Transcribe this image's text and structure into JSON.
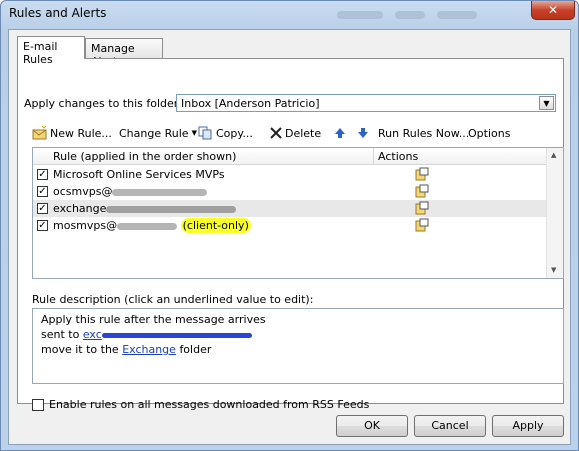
{
  "window": {
    "title": "Rules and Alerts",
    "close_glyph": "✕"
  },
  "tabs": [
    {
      "label": "E-mail Rules",
      "active": true
    },
    {
      "label": "Manage Alerts",
      "active": false
    }
  ],
  "folder": {
    "label": "Apply changes to this folder:",
    "value": "Inbox [Anderson Patricio]"
  },
  "toolbar": {
    "new_rule": "New Rule...",
    "change_rule": "Change Rule",
    "copy": "Copy...",
    "delete": "Delete",
    "run_rules": "Run Rules Now...",
    "options": "Options"
  },
  "rules_list": {
    "headers": {
      "rule": "Rule (applied in the order shown)",
      "actions": "Actions"
    },
    "rows": [
      {
        "checked": true,
        "prefix": "Microsoft Online Services MVPs",
        "redacted": false,
        "suffix": "",
        "selected": false
      },
      {
        "checked": true,
        "prefix": "ocsmvps@",
        "redacted": true,
        "suffix": "",
        "selected": false
      },
      {
        "checked": true,
        "prefix": "exchange",
        "redacted": true,
        "suffix": "",
        "selected": true
      },
      {
        "checked": true,
        "prefix": "mosmvps@",
        "redacted": true,
        "suffix": "(client-only)",
        "selected": false
      }
    ]
  },
  "description": {
    "label": "Rule description (click an underlined value to edit):",
    "line1": "Apply this rule after the message arrives",
    "line2_prefix": "sent to",
    "line2_link": "exc",
    "line3_prefix": "move it to the",
    "line3_link": "Exchange",
    "line3_suffix": "folder"
  },
  "rss_option": {
    "label": "Enable rules on all messages downloaded from RSS Feeds",
    "checked": false
  },
  "buttons": {
    "ok": "OK",
    "cancel": "Cancel",
    "apply": "Apply"
  },
  "colors": {
    "highlight": "#f8ff2a",
    "link": "#1a3eb8"
  }
}
